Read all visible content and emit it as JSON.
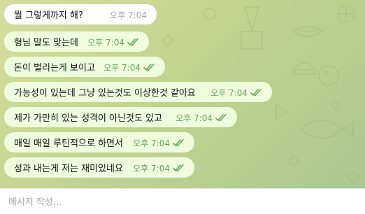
{
  "messages": [
    {
      "text": "뭘 그렇게까지 해?",
      "time": "오후 7:04",
      "direction": "in"
    },
    {
      "text": "형님 말도 맞는데",
      "time": "오후 7:04",
      "direction": "out",
      "status": "read"
    },
    {
      "text": "돈이 벌리는게 보이고",
      "time": "오후 7:04",
      "direction": "out",
      "status": "read"
    },
    {
      "text": "가능성이 있는데 그냥 있는것도 이상한것 같아요",
      "time": "오후 7:04",
      "direction": "out",
      "status": "read"
    },
    {
      "text": "제가 가만히 있는 성격이 아닌것도 있고",
      "time": "오후 7:04",
      "direction": "out",
      "status": "read"
    },
    {
      "text": "매일 매일 루틴적으로 하면서",
      "time": "오후 7:04",
      "direction": "out",
      "status": "read"
    },
    {
      "text": "성과 내는게 저는 재미있네요",
      "time": "오후 7:04",
      "direction": "out",
      "status": "read"
    }
  ],
  "composer": {
    "placeholder": "메시지 작성..."
  },
  "colors": {
    "background": "#c3d390",
    "incoming_bubble": "#ffffff",
    "outgoing_bubble": "#effdde",
    "read_check": "#5fa85a",
    "incoming_time": "#a0a6ab"
  },
  "icons": {
    "read_status": "double-check-icon"
  }
}
